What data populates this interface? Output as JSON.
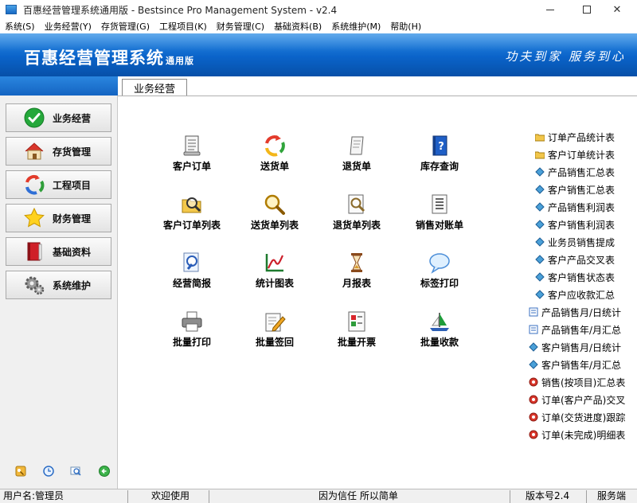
{
  "window": {
    "title": "百惠经营管理系统通用版 - Bestsince Pro Management System - v2.4"
  },
  "menu": [
    "系统(S)",
    "业务经营(Y)",
    "存货管理(G)",
    "工程项目(K)",
    "财务管理(C)",
    "基础资料(B)",
    "系统维护(M)",
    "帮助(H)"
  ],
  "banner": {
    "brand": "百惠经营管理系统",
    "edition": "通用版",
    "slogan": "功夫到家 服务到心"
  },
  "sidebar": {
    "items": [
      {
        "label": "业务经营",
        "icon": "check-icon"
      },
      {
        "label": "存货管理",
        "icon": "house-icon"
      },
      {
        "label": "工程项目",
        "icon": "recycle-arrows-icon"
      },
      {
        "label": "财务管理",
        "icon": "star-icon"
      },
      {
        "label": "基础资料",
        "icon": "red-book-icon"
      },
      {
        "label": "系统维护",
        "icon": "gears-icon"
      }
    ],
    "bottom_icons": [
      "key-icon",
      "clock-icon",
      "preview-icon",
      "back-arrow-icon"
    ]
  },
  "main": {
    "tab": "业务经营",
    "tiles": [
      {
        "label": "客户订单",
        "icon": "document-icon"
      },
      {
        "label": "送货单",
        "icon": "delivery-arrows-icon"
      },
      {
        "label": "退货单",
        "icon": "scroll-icon"
      },
      {
        "label": "库存查询",
        "icon": "help-book-icon"
      },
      {
        "label": "客户订单列表",
        "icon": "search-folder-icon"
      },
      {
        "label": "送货单列表",
        "icon": "magnifier-icon"
      },
      {
        "label": "退货单列表",
        "icon": "search-page-icon"
      },
      {
        "label": "销售对账单",
        "icon": "list-document-icon"
      },
      {
        "label": "经营简报",
        "icon": "report-search-icon"
      },
      {
        "label": "统计图表",
        "icon": "line-chart-icon"
      },
      {
        "label": "月报表",
        "icon": "hourglass-icon"
      },
      {
        "label": "标签打印",
        "icon": "speech-bubble-icon"
      },
      {
        "label": "批量打印",
        "icon": "printer-icon"
      },
      {
        "label": "批量签回",
        "icon": "pen-paper-icon"
      },
      {
        "label": "批量开票",
        "icon": "invoice-icon"
      },
      {
        "label": "批量收款",
        "icon": "collect-ship-icon"
      }
    ],
    "reports": [
      {
        "label": "订单产品统计表",
        "icon": "folder-icon"
      },
      {
        "label": "客户订单统计表",
        "icon": "folder-icon"
      },
      {
        "label": "产品销售汇总表",
        "icon": "report-diamond-icon"
      },
      {
        "label": "客户销售汇总表",
        "icon": "report-diamond-icon"
      },
      {
        "label": "产品销售利润表",
        "icon": "report-diamond-icon"
      },
      {
        "label": "客户销售利润表",
        "icon": "report-diamond-icon"
      },
      {
        "label": "业务员销售提成",
        "icon": "report-diamond-icon"
      },
      {
        "label": "客户产品交叉表",
        "icon": "report-diamond-icon"
      },
      {
        "label": "客户销售状态表",
        "icon": "report-diamond-icon"
      },
      {
        "label": "客户应收款汇总",
        "icon": "report-diamond-icon"
      },
      {
        "label": "产品销售月/日统计",
        "icon": "report-page-icon"
      },
      {
        "label": "产品销售年/月汇总",
        "icon": "report-page-icon"
      },
      {
        "label": "客户销售月/日统计",
        "icon": "report-diamond-icon"
      },
      {
        "label": "客户销售年/月汇总",
        "icon": "report-diamond-icon"
      },
      {
        "label": "销售(按项目)汇总表",
        "icon": "report-red-icon"
      },
      {
        "label": "订单(客户产品)交叉",
        "icon": "report-red-icon"
      },
      {
        "label": "订单(交货进度)跟踪",
        "icon": "report-red-icon"
      },
      {
        "label": "订单(未完成)明细表",
        "icon": "report-red-icon"
      }
    ]
  },
  "statusbar": {
    "user": "用户名:管理员",
    "welcome": "欢迎使用",
    "motto": "因为信任 所以简单",
    "version": "版本号2.4",
    "mode": "服务端"
  }
}
